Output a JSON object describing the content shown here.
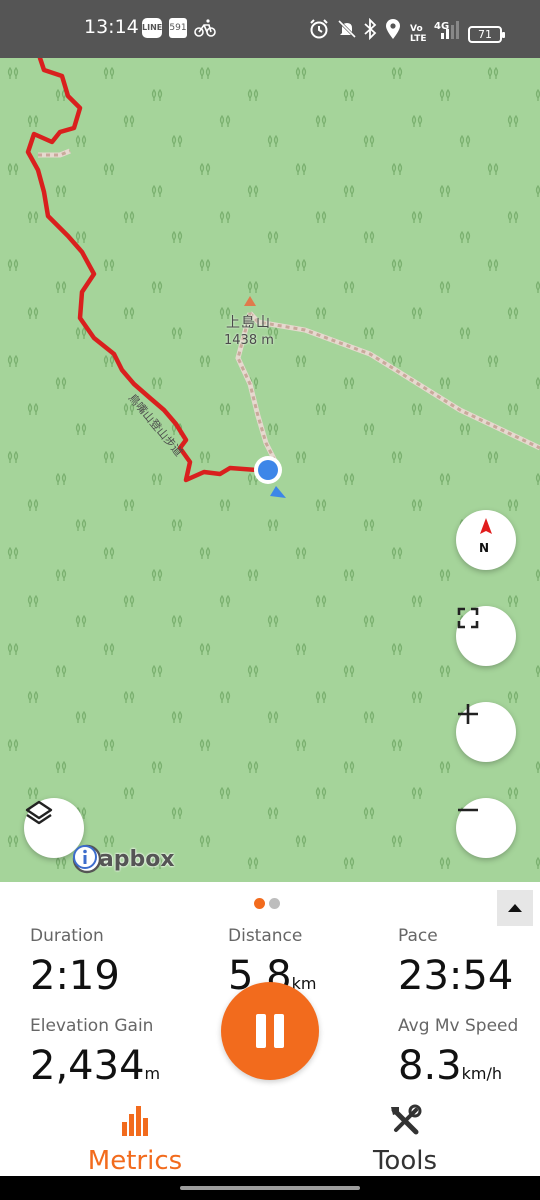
{
  "status_bar": {
    "time": "13:14",
    "app_icons": [
      "line-icon",
      "badge-icon",
      "bike-icon"
    ],
    "badge_text": "591",
    "line_text": "LINE",
    "right_icons": [
      "alarm-icon",
      "mute-icon",
      "bluetooth-icon",
      "location-icon",
      "volte-icon",
      "signal-icon",
      "battery-icon"
    ],
    "volte_text": "Vo LTE",
    "network_text": "4G",
    "battery_level": "71"
  },
  "map": {
    "peak_name": "上島山",
    "peak_elevation": "1438 m",
    "trail_label": "鳥嘴山登山步道",
    "track_color": "#d9201e",
    "location_color": "#3d86e8",
    "compass_label": "N",
    "attribution": "mapbox",
    "buttons": [
      "compass-button",
      "fullscreen-button",
      "zoom-in-button",
      "zoom-out-button",
      "layers-button"
    ]
  },
  "panel": {
    "page_indicator": {
      "current": 1,
      "total": 2
    },
    "metrics": {
      "duration": {
        "label": "Duration",
        "value": "2:19",
        "unit": ""
      },
      "distance": {
        "label": "Distance",
        "value": "5.8",
        "unit": "km"
      },
      "pace": {
        "label": "Pace",
        "value": "23:54",
        "unit": ""
      },
      "elevation_gain": {
        "label": "Elevation Gain",
        "value": "2,434",
        "unit": "m"
      },
      "avg_mv_speed": {
        "label": "Avg Mv Speed",
        "value": "8.3",
        "unit": "km/h"
      }
    },
    "nav": {
      "metrics_label": "Metrics",
      "tools_label": "Tools"
    },
    "accent_color": "#f26b1d"
  }
}
